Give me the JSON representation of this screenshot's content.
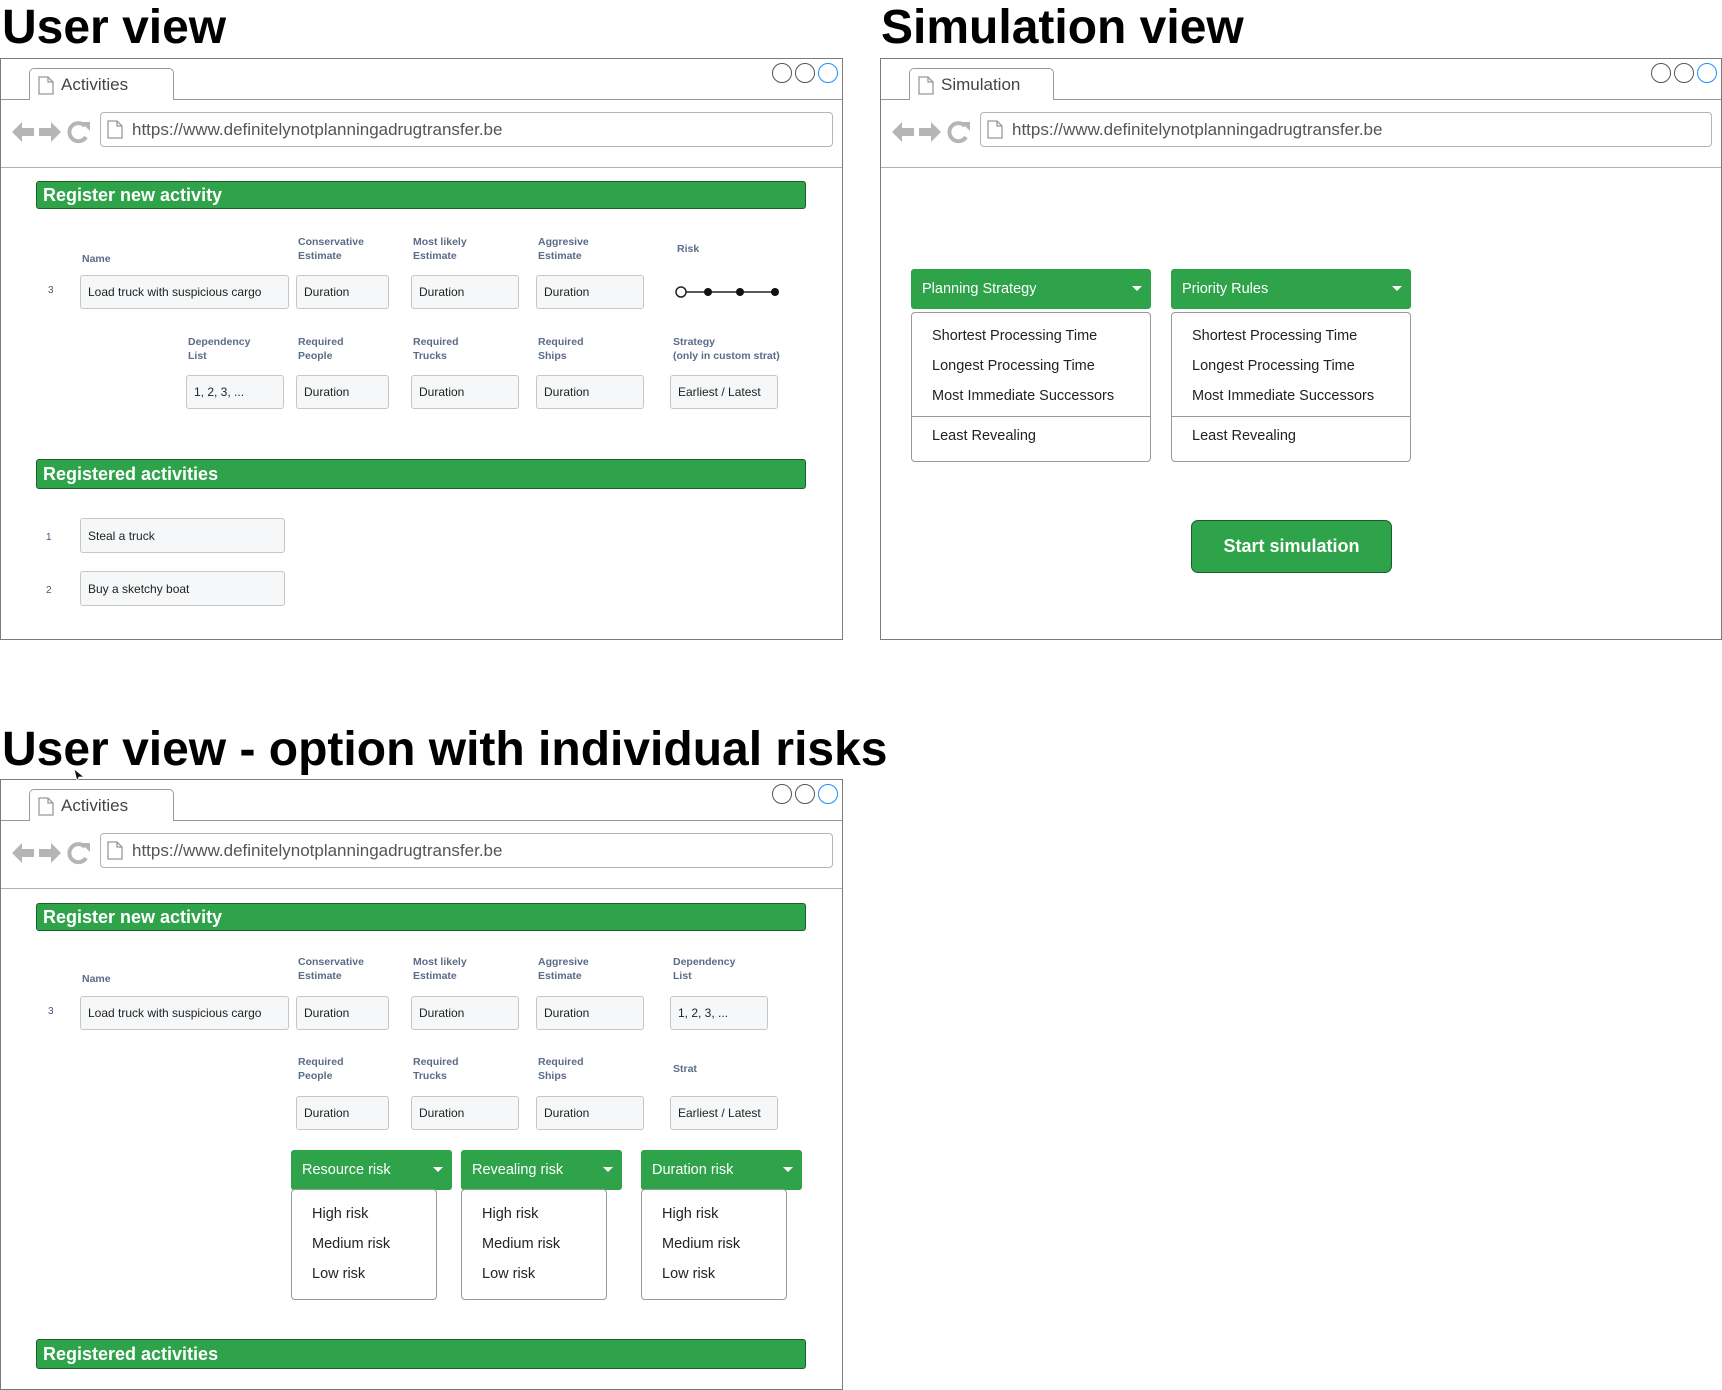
{
  "headings": {
    "user_view": "User view",
    "simulation_view": "Simulation view",
    "user_view_option": "User view - option with individual risks"
  },
  "browser": {
    "url": "https://www.definitelynotplanningadrugtransfer.be",
    "tab_activities": "Activities",
    "tab_simulation": "Simulation"
  },
  "user_view": {
    "register_title": "Register new activity",
    "row_number": "3",
    "labels": {
      "name": "Name",
      "conservative": [
        "Conservative",
        "Estimate"
      ],
      "most_likely": [
        "Most likely",
        "Estimate"
      ],
      "aggressive": [
        "Aggresive",
        "Estimate"
      ],
      "risk": "Risk",
      "dependency": [
        "Dependency",
        "List"
      ],
      "people": [
        "Required",
        "People"
      ],
      "trucks": [
        "Required",
        "Trucks"
      ],
      "ships": [
        "Required",
        "Ships"
      ],
      "strategy": [
        "Strategy",
        "(only in custom strat)"
      ]
    },
    "fields": {
      "name": "Load truck with suspicious cargo",
      "conservative": "Duration",
      "most_likely": "Duration",
      "aggressive": "Duration",
      "dependency": "1, 2, 3, ...",
      "people": "Duration",
      "trucks": "Duration",
      "ships": "Duration",
      "strategy": "Earliest / Latest"
    },
    "risk_slider": {
      "levels": 4,
      "selected_index": 0
    },
    "registered_title": "Registered activities",
    "registered": [
      {
        "num": "1",
        "name": "Steal a truck"
      },
      {
        "num": "2",
        "name": "Buy a sketchy boat"
      }
    ]
  },
  "simulation_view": {
    "planning_strategy": {
      "label": "Planning Strategy",
      "options": [
        "Shortest Processing Time",
        "Longest Processing Time",
        "Most Immediate Successors",
        "Least Revealing"
      ]
    },
    "priority_rules": {
      "label": "Priority Rules",
      "options": [
        "Shortest Processing Time",
        "Longest Processing Time",
        "Most Immediate Successors",
        "Least Revealing"
      ]
    },
    "start_button": "Start simulation"
  },
  "option_view": {
    "register_title": "Register new activity",
    "row_number": "3",
    "labels": {
      "name": "Name",
      "conservative": [
        "Conservative",
        "Estimate"
      ],
      "most_likely": [
        "Most likely",
        "Estimate"
      ],
      "aggressive": [
        "Aggresive",
        "Estimate"
      ],
      "dependency": [
        "Dependency",
        "List"
      ],
      "people": [
        "Required",
        "People"
      ],
      "trucks": [
        "Required",
        "Trucks"
      ],
      "ships": [
        "Required",
        "Ships"
      ],
      "strat": "Strat"
    },
    "fields": {
      "name": "Load truck with suspicious cargo",
      "conservative": "Duration",
      "most_likely": "Duration",
      "aggressive": "Duration",
      "dependency": "1, 2, 3, ...",
      "people": "Duration",
      "trucks": "Duration",
      "ships": "Duration",
      "strat": "Earliest / Latest"
    },
    "resource_risk": {
      "label": "Resource risk",
      "options": [
        "High risk",
        "Medium risk",
        "Low risk"
      ]
    },
    "revealing_risk": {
      "label": "Revealing risk",
      "options": [
        "High risk",
        "Medium risk",
        "Low risk"
      ]
    },
    "duration_risk": {
      "label": "Duration risk",
      "options": [
        "High risk",
        "Medium risk",
        "Low risk"
      ]
    },
    "registered_title": "Registered activities"
  },
  "colors": {
    "accent_green": "#2ea34a",
    "accent_border": "#1a5e28",
    "label_text": "#5b6b88",
    "window_close_blue": "#1e90ff"
  }
}
